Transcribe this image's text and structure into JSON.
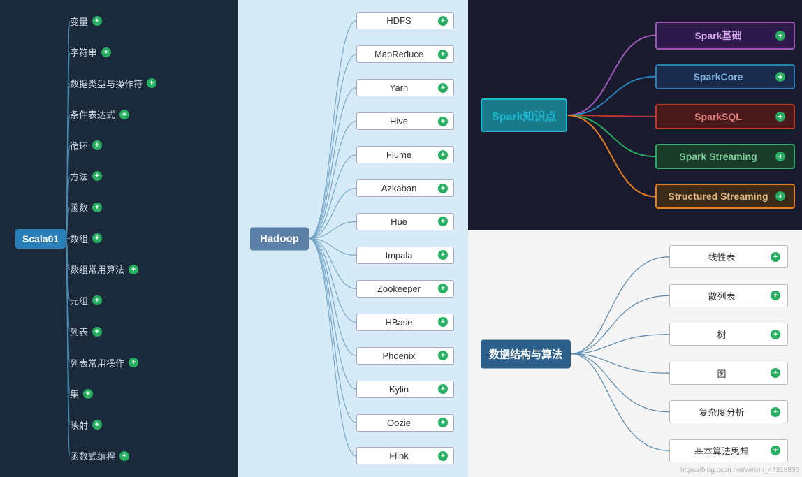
{
  "left": {
    "root": "Scala01",
    "items": [
      {
        "label": "变量",
        "plus": "+",
        "plusColor": "green"
      },
      {
        "label": "字符串",
        "plus": "+",
        "plusColor": "green"
      },
      {
        "label": "数据类型与操作符",
        "plus": "+",
        "plusColor": "green"
      },
      {
        "label": "条件表达式",
        "plus": "+",
        "plusColor": "green"
      },
      {
        "label": "循环",
        "plus": "+",
        "plusColor": "green"
      },
      {
        "label": "方法",
        "plus": "+",
        "plusColor": "green"
      },
      {
        "label": "函数",
        "plus": "+",
        "plusColor": "green"
      },
      {
        "label": "数组",
        "plus": "+",
        "plusColor": "blue"
      },
      {
        "label": "数组常用算法",
        "plus": "+",
        "plusColor": "green"
      },
      {
        "label": "元组",
        "plus": "+",
        "plusColor": "green"
      },
      {
        "label": "列表",
        "plus": "+",
        "plusColor": "green"
      },
      {
        "label": "列表常用操作",
        "plus": "+",
        "plusColor": "green"
      },
      {
        "label": "集",
        "plus": "+",
        "plusColor": "green"
      },
      {
        "label": "映射",
        "plus": "+",
        "plusColor": "green"
      },
      {
        "label": "函数式编程",
        "plus": "+",
        "plusColor": "green"
      }
    ]
  },
  "middle": {
    "root": "Hadoop",
    "items": [
      {
        "label": "HDFS",
        "plus": "+"
      },
      {
        "label": "MapReduce",
        "plus": "+"
      },
      {
        "label": "Yarn",
        "plus": "+"
      },
      {
        "label": "Hive",
        "plus": "+"
      },
      {
        "label": "Flume",
        "plus": "+"
      },
      {
        "label": "Azkaban",
        "plus": "+"
      },
      {
        "label": "Hue",
        "plus": "+"
      },
      {
        "label": "Impala",
        "plus": "+"
      },
      {
        "label": "Zookeeper",
        "plus": "+"
      },
      {
        "label": "HBase",
        "plus": "+"
      },
      {
        "label": "Phoenix",
        "plus": "+"
      },
      {
        "label": "Kylin",
        "plus": "+"
      },
      {
        "label": "Oozie",
        "plus": "+"
      },
      {
        "label": "Flink",
        "plus": "+"
      }
    ]
  },
  "spark": {
    "root": "Spark知识点",
    "items": [
      {
        "label": "Spark基础",
        "plus": "+",
        "class": "spark-jichu"
      },
      {
        "label": "SparkCore",
        "plus": "+",
        "class": "spark-core"
      },
      {
        "label": "SparkSQL",
        "plus": "+",
        "class": "spark-sql"
      },
      {
        "label": "Spark Streaming",
        "plus": "+",
        "class": "spark-streaming"
      },
      {
        "label": "Structured Streaming",
        "plus": "+",
        "class": "spark-structured"
      }
    ]
  },
  "ds": {
    "root": "数据结构与算法",
    "items": [
      {
        "label": "线性表",
        "plus": "+"
      },
      {
        "label": "散列表",
        "plus": "+"
      },
      {
        "label": "树",
        "plus": "+"
      },
      {
        "label": "图",
        "plus": "+"
      },
      {
        "label": "复杂度分析",
        "plus": "+"
      },
      {
        "label": "基本算法思想",
        "plus": "+"
      }
    ]
  },
  "watermark": "https://blog.csdn.net/weixin_44318830"
}
